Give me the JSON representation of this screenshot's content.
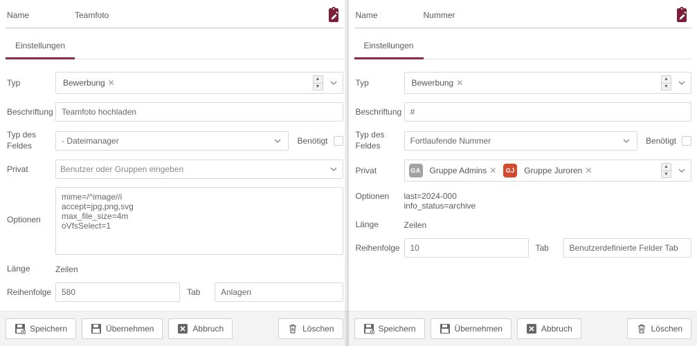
{
  "labels": {
    "name": "Name",
    "tab_settings": "Einstellungen",
    "typ": "Typ",
    "beschriftung": "Beschriftung",
    "typ_des_feldes": "Typ des Feldes",
    "benoetigt": "Benötigt",
    "privat": "Privat",
    "optionen": "Optionen",
    "laenge": "Länge",
    "zeilen": "Zeilen",
    "reihenfolge": "Reihenfolge",
    "tab": "Tab"
  },
  "buttons": {
    "speichern": "Speichern",
    "uebernehmen": "Übernehmen",
    "abbruch": "Abbruch",
    "loeschen": "Löschen"
  },
  "left": {
    "name": "Teamfoto",
    "typ_chip": "Bewerbung",
    "beschriftung": "Teamfoto hochladen",
    "feld_typ": "- Dateimanager",
    "privat_placeholder": "Benutzer oder Gruppen eingeben",
    "optionen_text": "mime=/^image//i\naccept=jpg,png,svg\nmax_file_size=4m\noVfsSelect=1",
    "reihenfolge": "580",
    "tab_value": "Anlagen"
  },
  "right": {
    "name": "Nummer",
    "typ_chip": "Bewerbung",
    "beschriftung": "#",
    "feld_typ": "Fortlaufende Nummer",
    "privat_group1_badge": "GA",
    "privat_group1_label": "Gruppe Admins",
    "privat_group2_badge": "GJ",
    "privat_group2_label": "Gruppe Juroren",
    "optionen_text": "last=2024-000\ninfo_status=archive",
    "reihenfolge": "10",
    "tab_value": "Benutzerdefinierte Felder Tab"
  }
}
